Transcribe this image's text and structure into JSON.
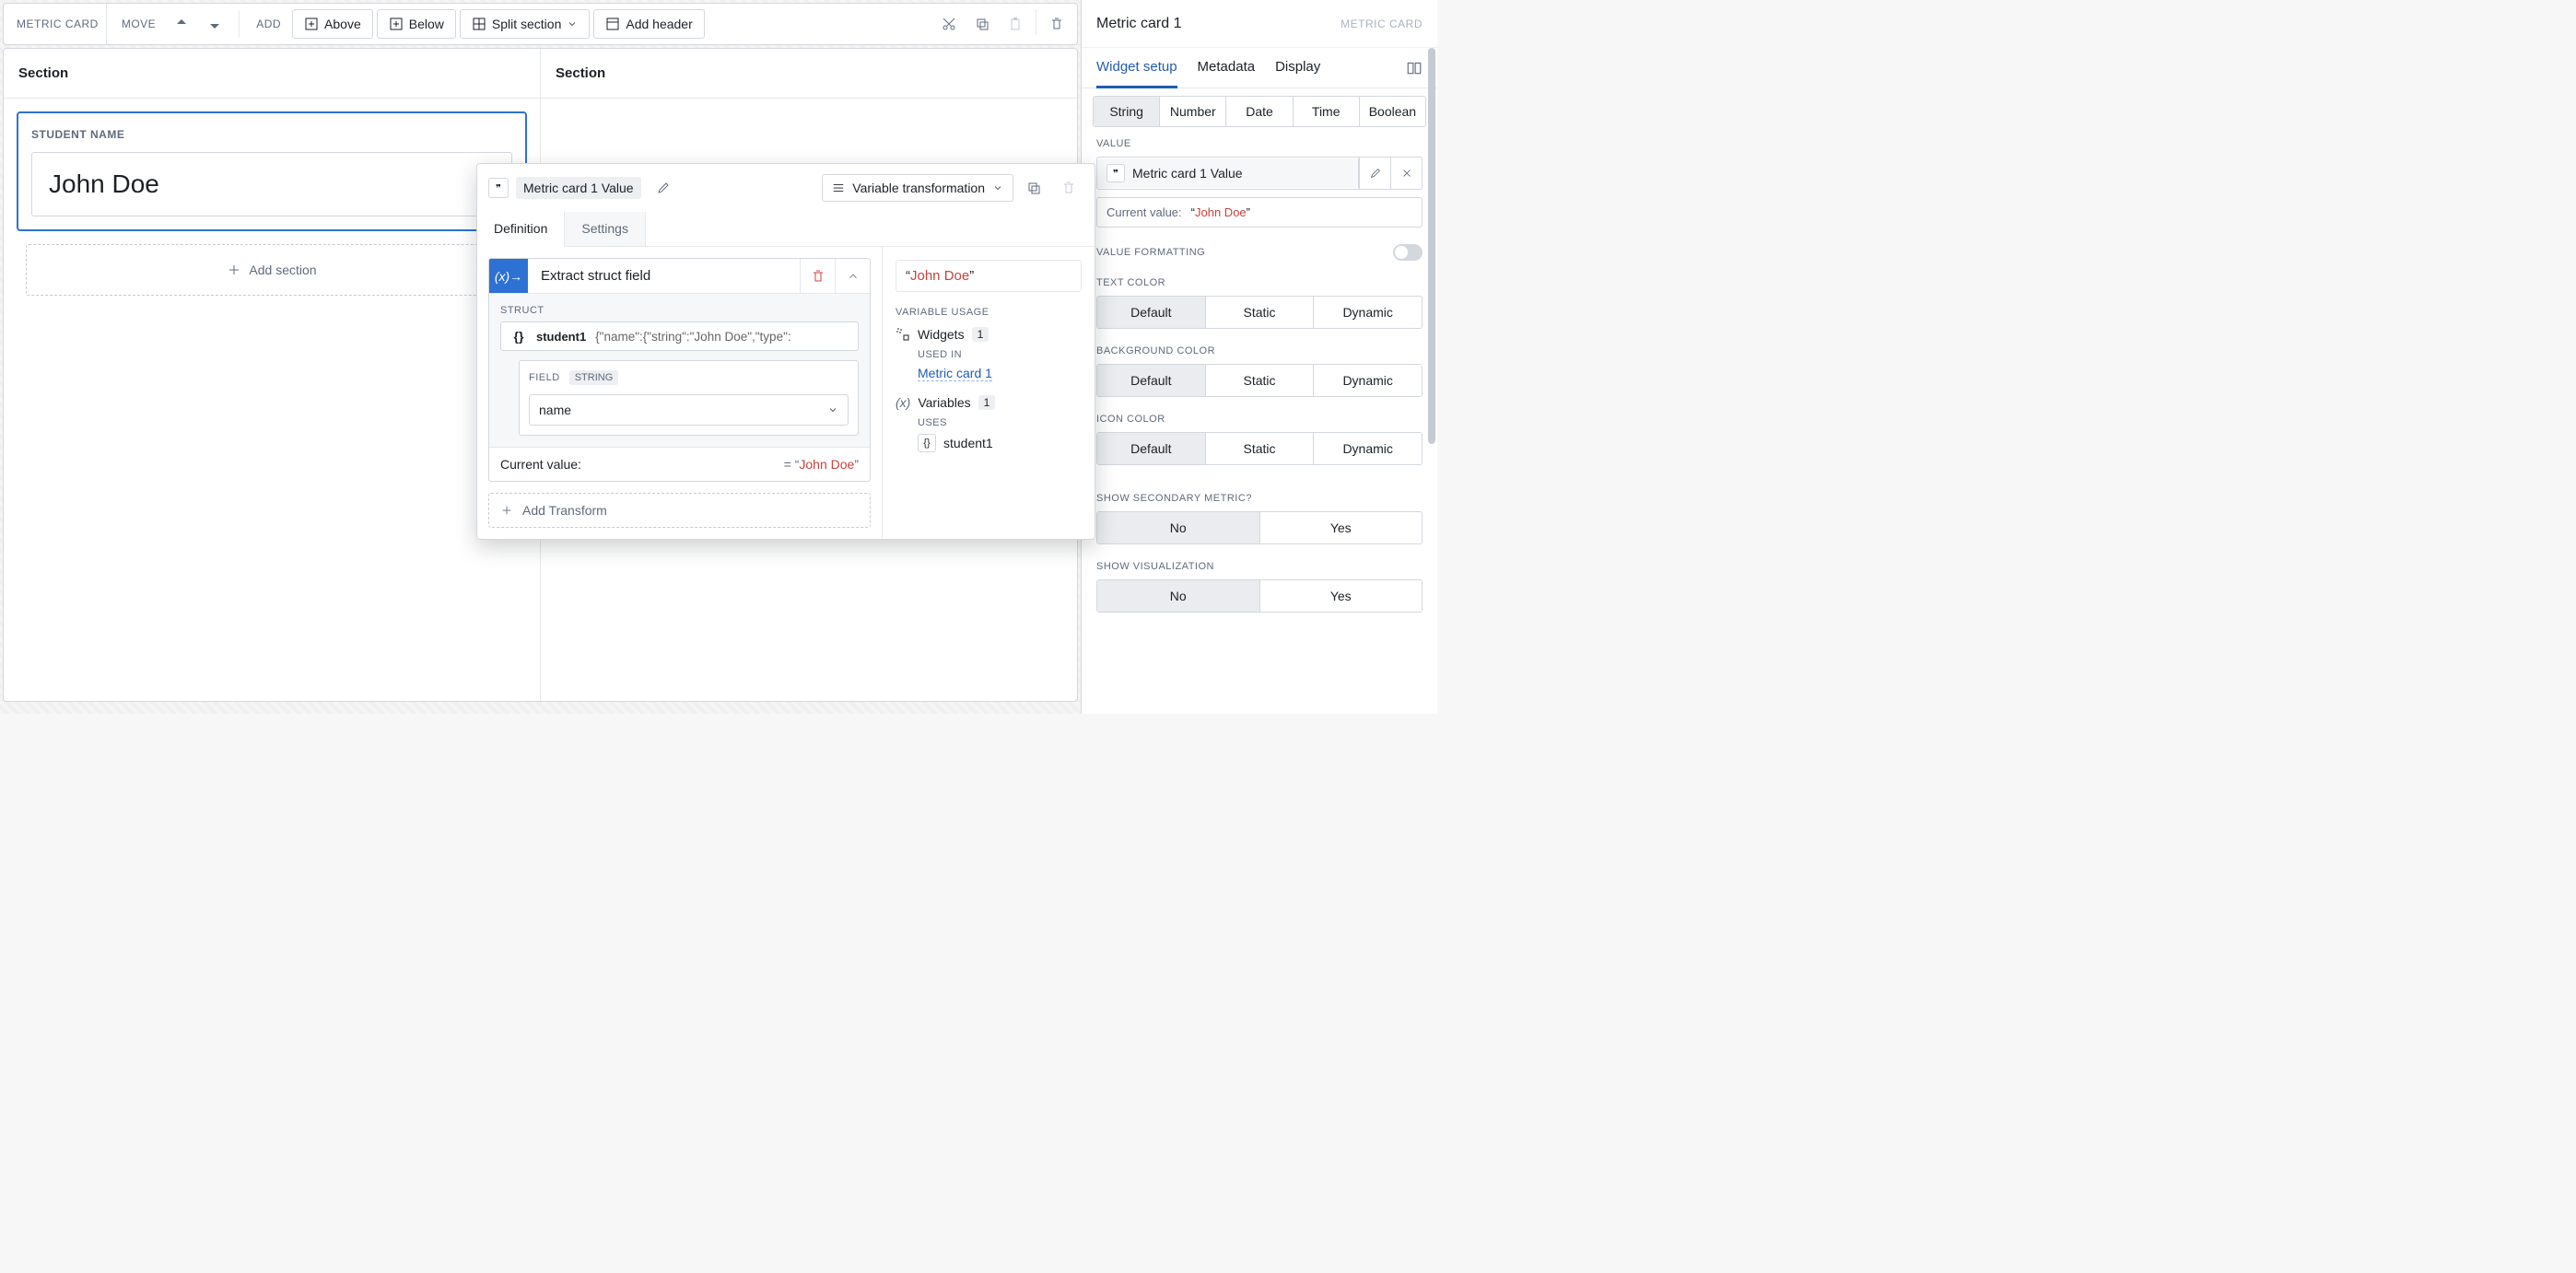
{
  "toolbar": {
    "breadcrumb": "METRIC CARD",
    "move_label": "MOVE",
    "add_label": "ADD",
    "above": "Above",
    "below": "Below",
    "split": "Split section",
    "add_header": "Add header"
  },
  "sections": {
    "left_title": "Section",
    "right_title": "Section",
    "card_label": "STUDENT NAME",
    "card_value": "John Doe",
    "add_section": "Add section"
  },
  "popover": {
    "title_chip": "Metric card 1 Value",
    "transform_mode": "Variable transformation",
    "tabs": {
      "definition": "Definition",
      "settings": "Settings"
    },
    "extract_title": "Extract struct field",
    "struct_label": "STRUCT",
    "struct_name": "student1",
    "struct_json": "{\"name\":{\"string\":\"John Doe\",\"type\":",
    "field_label": "FIELD",
    "field_type_tag": "STRING",
    "field_value": "name",
    "current_value_label": "Current value:",
    "current_value_prefix": "= “",
    "current_value": "John Doe",
    "current_value_suffix": "”",
    "add_transform": "Add Transform",
    "preview_prefix": "“",
    "preview_value": "John Doe",
    "preview_suffix": "”",
    "usage_header": "VARIABLE USAGE",
    "widgets_label": "Widgets",
    "widgets_count": "1",
    "used_in": "USED IN",
    "used_in_link": "Metric card 1",
    "variables_label": "Variables",
    "variables_count": "1",
    "uses": "USES",
    "uses_var": "student1"
  },
  "rpanel": {
    "title": "Metric card 1",
    "subtitle": "METRIC CARD",
    "tabs": {
      "setup": "Widget setup",
      "metadata": "Metadata",
      "display": "Display"
    },
    "type_tabs": [
      "String",
      "Number",
      "Date",
      "Time",
      "Boolean"
    ],
    "value_label": "VALUE",
    "value_chip": "Metric card 1 Value",
    "current_value_label": "Current value:",
    "current_value_prefix": "“",
    "current_value": "John Doe",
    "current_value_suffix": "”",
    "value_formatting": "VALUE FORMATTING",
    "text_color": "TEXT COLOR",
    "background_color": "BACKGROUND COLOR",
    "icon_color": "ICON COLOR",
    "color_options": [
      "Default",
      "Static",
      "Dynamic"
    ],
    "show_secondary": "SHOW SECONDARY METRIC?",
    "show_viz": "SHOW VISUALIZATION",
    "yn": [
      "No",
      "Yes"
    ]
  }
}
